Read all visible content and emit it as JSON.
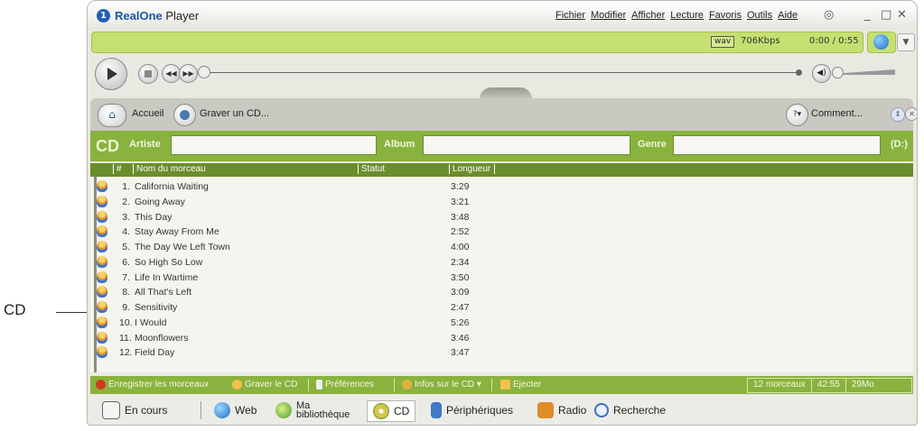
{
  "callout": {
    "label": "CD"
  },
  "window": {
    "brand": "RealOne",
    "title": "Player",
    "menu": [
      "Fichier",
      "Modifier",
      "Afficher",
      "Lecture",
      "Favoris",
      "Outils",
      "Aide"
    ],
    "controls": {
      "minimize": "_",
      "maximize": "□",
      "close": "✕"
    }
  },
  "status": {
    "format": "wav",
    "bitrate": "706Kbps",
    "time": "0:00 / 0:55"
  },
  "nav": {
    "home_label": "Accueil",
    "burn_label": "Graver un CD...",
    "comment_label": "Comment..."
  },
  "cd_info": {
    "cd_label": "CD",
    "artist_label": "Artiste",
    "artist_value": "",
    "album_label": "Album",
    "album_value": "",
    "genre_label": "Genre",
    "genre_value": "",
    "drive": "(D:)"
  },
  "tracklist": {
    "columns": [
      "#",
      "Nom du morceau",
      "Statut",
      "Longueur"
    ],
    "tracks": [
      {
        "num": "1.",
        "name": "California Waiting",
        "duration": "3:29"
      },
      {
        "num": "2.",
        "name": "Going Away",
        "duration": "3:21"
      },
      {
        "num": "3.",
        "name": "This Day",
        "duration": "3:48"
      },
      {
        "num": "4.",
        "name": "Stay Away From Me",
        "duration": "2:52"
      },
      {
        "num": "5.",
        "name": "The Day We Left Town",
        "duration": "4:00"
      },
      {
        "num": "6.",
        "name": "So High So Low",
        "duration": "2:34"
      },
      {
        "num": "7.",
        "name": "Life In Wartime",
        "duration": "3:50"
      },
      {
        "num": "8.",
        "name": "All That's Left",
        "duration": "3:09"
      },
      {
        "num": "9.",
        "name": "Sensitivity",
        "duration": "2:47"
      },
      {
        "num": "10.",
        "name": "I Would",
        "duration": "5:26"
      },
      {
        "num": "11.",
        "name": "Moonflowers",
        "duration": "3:46"
      },
      {
        "num": "12.",
        "name": "Field Day",
        "duration": "3:47"
      }
    ]
  },
  "actions": {
    "record": "Enregistrer les morceaux",
    "burn": "Graver le CD",
    "preferences": "Préférences",
    "cd_info": "Infos sur le CD ▾",
    "eject": "Ejecter",
    "summary": {
      "tracks": "12 morceaux",
      "length": "42:55",
      "size": "29Mo"
    }
  },
  "taskbar": {
    "now_playing": "En cours",
    "web": "Web",
    "library_line1": "Ma",
    "library_line2": "bibliothèque",
    "cd": "CD",
    "devices": "Périphériques",
    "radio": "Radio",
    "search": "Recherche"
  },
  "colors": {
    "status_green": "#c5e071",
    "cd_bar_green": "#8ab23e",
    "header_green": "#6a8e2b",
    "brand_blue": "#1d58a8"
  },
  "icons": [
    "realone-logo-icon",
    "play-icon",
    "stop-icon",
    "previous-icon",
    "next-icon",
    "volume-icon",
    "home-icon",
    "burn-cd-icon",
    "comment-icon",
    "track-cd-icon",
    "record-icon",
    "eject-icon",
    "globe-icon"
  ]
}
